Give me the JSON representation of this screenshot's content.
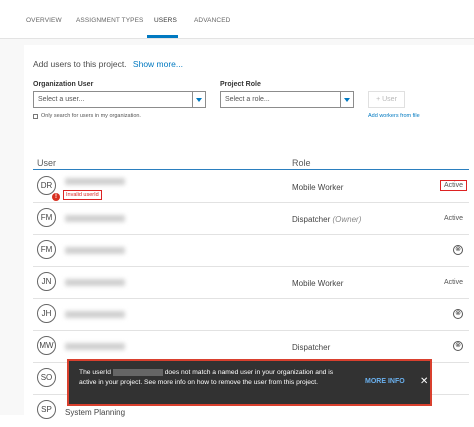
{
  "tabs": [
    {
      "label": "OVERVIEW"
    },
    {
      "label": "ASSIGNMENT TYPES"
    },
    {
      "label": "USERS"
    },
    {
      "label": "ADVANCED"
    }
  ],
  "add_users": {
    "title": "Add users to this project.",
    "show_more": "Show more...",
    "org_user_label": "Organization User",
    "org_user_placeholder": "Select a user...",
    "role_label": "Project Role",
    "role_placeholder": "Select a role...",
    "add_button": "+ User",
    "only_search_label": "Only search for users in my organization.",
    "add_from_file": "Add workers from file"
  },
  "table": {
    "col_user": "User",
    "col_role": "Role",
    "rows": [
      {
        "initials": "DR",
        "name": "",
        "role": "Mobile Worker",
        "owner": "",
        "status": "Active",
        "invalid": "Invalid userId"
      },
      {
        "initials": "FM",
        "name": "",
        "role": "Dispatcher",
        "owner": "(Owner)",
        "status": "Active"
      },
      {
        "initials": "FM",
        "name": "",
        "role": "",
        "owner": "",
        "status": "⊗"
      },
      {
        "initials": "JN",
        "name": "",
        "role": "Mobile Worker",
        "owner": "",
        "status": "Active"
      },
      {
        "initials": "JH",
        "name": "",
        "role": "",
        "owner": "",
        "status": "⊗"
      },
      {
        "initials": "MW",
        "name": "",
        "role": "Dispatcher",
        "owner": "",
        "status": "⊗"
      },
      {
        "initials": "SO",
        "name": "",
        "role": "",
        "owner": "",
        "status": ""
      },
      {
        "initials": "SP",
        "name": "System Planning",
        "role": "",
        "owner": "",
        "status": ""
      }
    ]
  },
  "toast": {
    "text_before": "The userId",
    "text_after": "does not match a named user in your organization and is active in your project. See more info on how to remove the user from this project.",
    "more_info": "MORE INFO",
    "close": "✕"
  },
  "colors": {
    "accent": "#0079c1",
    "error": "#d22222",
    "toast_bg": "#323232"
  }
}
